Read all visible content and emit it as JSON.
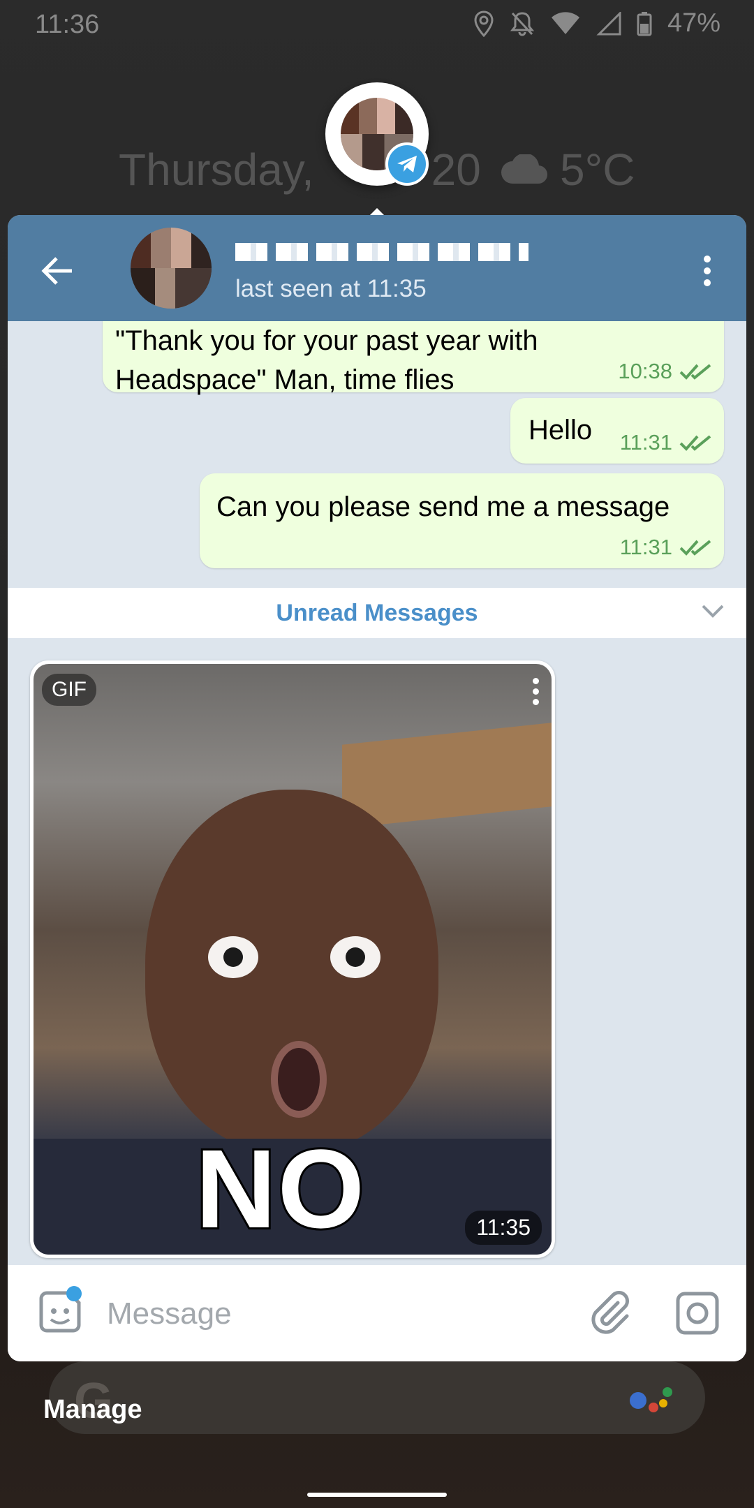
{
  "status_bar": {
    "time": "11:36",
    "battery": "47%",
    "icons": [
      "location-icon",
      "notifications-off-icon",
      "wifi-icon",
      "signal-icon",
      "battery-icon"
    ]
  },
  "lock_screen": {
    "date_text": "Thursday, ",
    "date_text_end": "20",
    "temperature": "5°C",
    "weather_icon": "cloud-icon"
  },
  "chat_header": {
    "contact_status": "last seen at 11:35"
  },
  "messages": [
    {
      "text_line1": "\"Thank you for your past year with",
      "text_line2": "Headspace\" Man, time flies",
      "time": "10:38",
      "status": "read"
    },
    {
      "text": "Hello",
      "time": "11:31",
      "status": "read"
    },
    {
      "text": "Can you please send me a message",
      "time": "11:31",
      "status": "read"
    }
  ],
  "unread_bar": {
    "label": "Unread Messages"
  },
  "gif_message": {
    "badge": "GIF",
    "caption": "NO",
    "time": "11:35"
  },
  "input_bar": {
    "placeholder": "Message"
  },
  "bubble": {
    "manage_label": "Manage"
  },
  "colors": {
    "header": "#517da2",
    "outgoing_bubble": "#efffde",
    "read_check": "#5aa05a",
    "accent": "#4a8fc9",
    "telegram_badge": "#3aa0e1"
  }
}
